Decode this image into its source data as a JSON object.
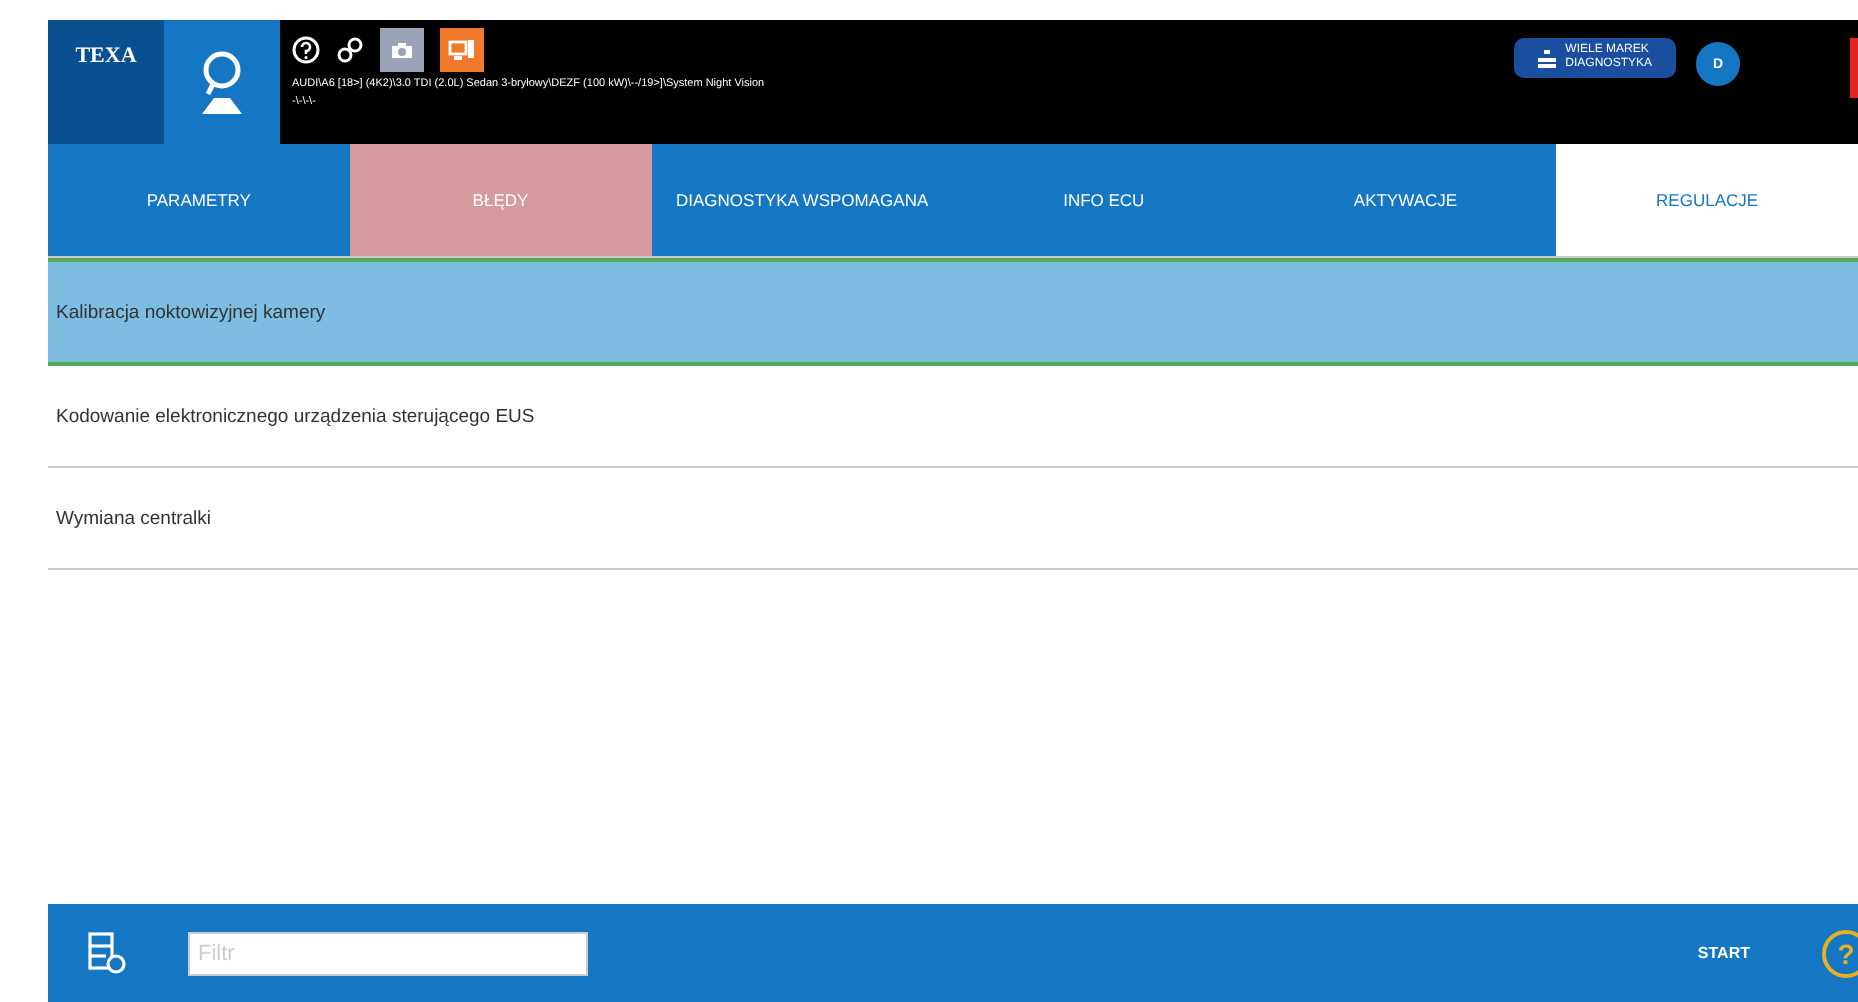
{
  "header": {
    "logo": "TEXA",
    "vehicle_path": "AUDI\\A6 [18>] (4K2)\\3.0 TDI (2.0L) Sedan 3-bryłowy\\DEZF (100 kW)\\--/19>]\\System Night Vision",
    "vehicle_sub": "-\\-\\-\\-",
    "mode_button": [
      "WIELE MAREK",
      "DIAGNOSTYKA"
    ],
    "user_badge": "D"
  },
  "tabs": [
    {
      "label": "PARAMETRY",
      "selected": false,
      "alert": false
    },
    {
      "label": "BŁĘDY",
      "selected": false,
      "alert": true
    },
    {
      "label": "DIAGNOSTYKA WSPOMAGANA",
      "selected": false,
      "alert": false
    },
    {
      "label": "INFO ECU",
      "selected": false,
      "alert": false
    },
    {
      "label": "AKTYWACJE",
      "selected": false,
      "alert": false
    },
    {
      "label": "REGULACJE",
      "selected": true,
      "alert": false
    }
  ],
  "rows": [
    {
      "label": "Kalibracja noktowizyjnej kamery",
      "selected": true
    },
    {
      "label": "Kodowanie elektronicznego urządzenia sterującego EUS",
      "selected": false
    },
    {
      "label": "Wymiana centralki",
      "selected": false
    }
  ],
  "footer": {
    "filter_placeholder": "Filtr",
    "start": "START",
    "help": "?"
  }
}
